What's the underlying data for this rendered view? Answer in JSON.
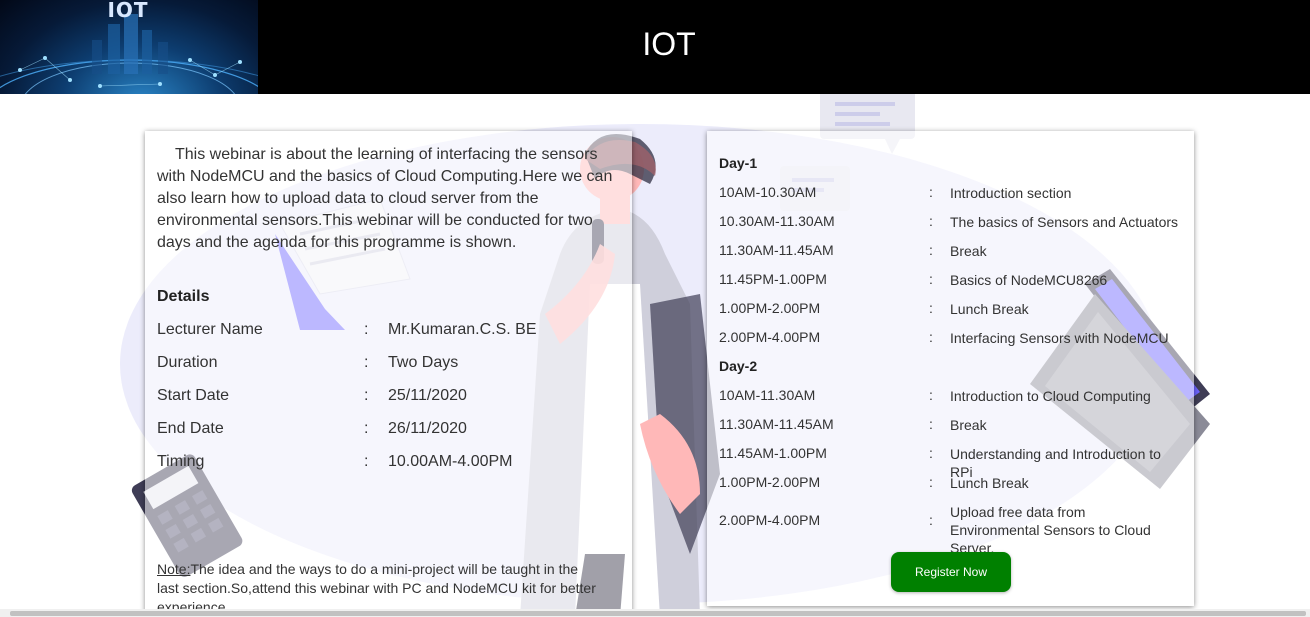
{
  "header": {
    "title": "IOT",
    "logo_text": "IOT"
  },
  "intro": "This webinar is about the learning of interfacing the sensors with NodeMCU and the basics of Cloud Computing.Here we can also learn how to upload data to cloud server from the environmental sensors.This webinar will be conducted for two days and the agenda for this programme is shown.",
  "details": {
    "title": "Details",
    "rows": [
      {
        "label": "Lecturer Name",
        "sep": ":",
        "value": "Mr.Kumaran.C.S. BE"
      },
      {
        "label": "Duration",
        "sep": ":",
        "value": "Two Days"
      },
      {
        "label": "Start Date",
        "sep": ":",
        "value": "25/11/2020"
      },
      {
        "label": "End Date",
        "sep": ":",
        "value": "26/11/2020"
      },
      {
        "label": "Timing",
        "sep": ":",
        "value": "10.00AM-4.00PM"
      }
    ]
  },
  "note": {
    "label": "Note:",
    "text": "The idea and the ways to do a mini-project will be taught in the last section.So,attend this webinar with PC and NodeMCU kit for better experience."
  },
  "schedule": {
    "day1": {
      "title": "Day-1",
      "rows": [
        {
          "time": "10AM-10.30AM",
          "sep": ":",
          "topic": "Introduction section"
        },
        {
          "time": "10.30AM-11.30AM",
          "sep": ":",
          "topic": "The basics of Sensors and Actuators"
        },
        {
          "time": "11.30AM-11.45AM",
          "sep": ":",
          "topic": "Break"
        },
        {
          "time": "11.45PM-1.00PM",
          "sep": ":",
          "topic": "Basics of NodeMCU8266"
        },
        {
          "time": "1.00PM-2.00PM",
          "sep": ":",
          "topic": "Lunch Break"
        },
        {
          "time": "2.00PM-4.00PM",
          "sep": ":",
          "topic": "Interfacing Sensors with NodeMCU"
        }
      ]
    },
    "day2": {
      "title": "Day-2",
      "rows": [
        {
          "time": "10AM-11.30AM",
          "sep": ":",
          "topic": "Introduction to Cloud Computing"
        },
        {
          "time": "11.30AM-11.45AM",
          "sep": ":",
          "topic": "Break"
        },
        {
          "time": "11.45AM-1.00PM",
          "sep": ":",
          "topic": "Understanding and Introduction to RPi"
        },
        {
          "time": "1.00PM-2.00PM",
          "sep": ":",
          "topic": "Lunch Break"
        },
        {
          "time": "2.00PM-4.00PM",
          "sep": ":",
          "topic": "Upload free data from Environmental Sensors to Cloud Server."
        }
      ]
    }
  },
  "register_button": "Register Now",
  "colors": {
    "header_bg": "#000000",
    "button_bg": "#008000",
    "illustration_accent": "#6c63ff"
  }
}
